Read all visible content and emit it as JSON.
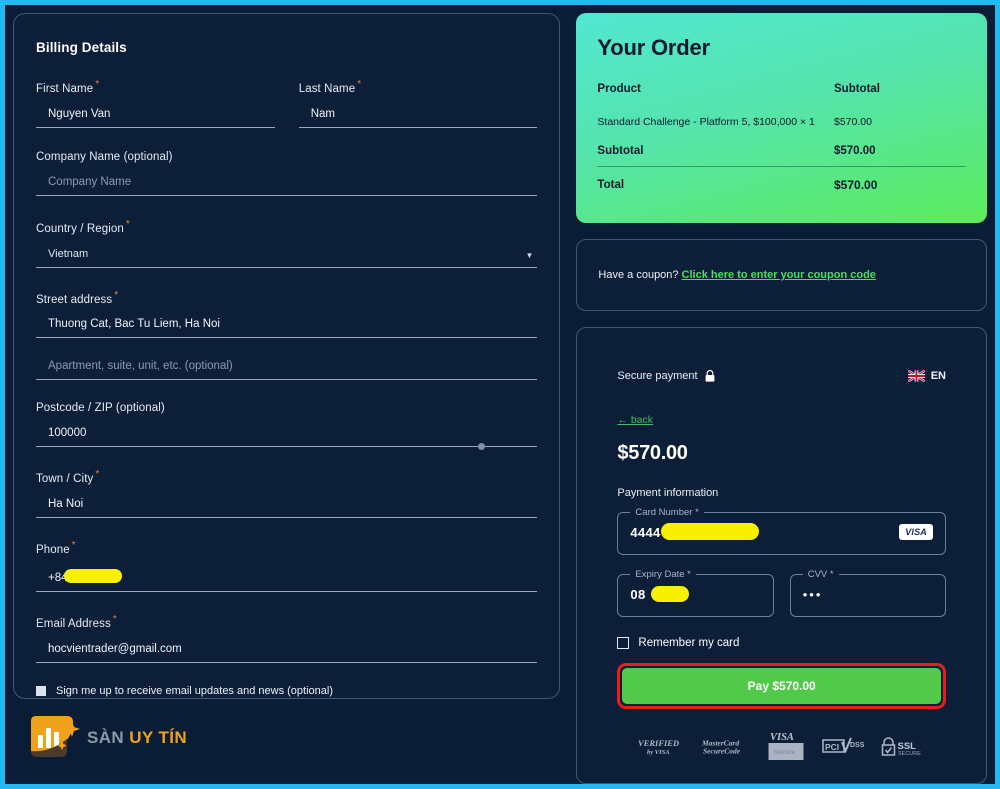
{
  "theme": {
    "outer_border": "#22b8f0",
    "page_bg": "#0b1d36",
    "panel_bg": "#0c1e38",
    "panel_border": "#3f5878",
    "required_mark": "#e8833a",
    "accent_green": "#4ade62",
    "pay_button_bg": "#52c94a",
    "annotation_red": "#ee1b1b",
    "redaction_yellow": "#f9f000",
    "order_gradient_from": "#52e7d2",
    "order_gradient_to": "#5ceb5b",
    "logo_orange": "#f0a21c"
  },
  "billing": {
    "title": "Billing Details",
    "first_name": {
      "label": "First Name",
      "required": true,
      "value": "Nguyen Van"
    },
    "last_name": {
      "label": "Last Name",
      "required": true,
      "value": "Nam"
    },
    "company": {
      "label": "Company Name (optional)",
      "required": false,
      "value": "",
      "placeholder": "Company Name"
    },
    "country": {
      "label": "Country / Region",
      "required": true,
      "value": "Vietnam"
    },
    "street": {
      "label": "Street address",
      "required": true,
      "value": "Thuong Cat, Bac Tu Liem, Ha Noi"
    },
    "street2": {
      "placeholder": "Apartment, suite, unit, etc. (optional)",
      "value": ""
    },
    "postcode": {
      "label": "Postcode / ZIP (optional)",
      "required": false,
      "value": "100000"
    },
    "city": {
      "label": "Town / City",
      "required": true,
      "value": "Ha Noi"
    },
    "phone": {
      "label": "Phone",
      "required": true,
      "value": "+84",
      "redacted": true
    },
    "email": {
      "label": "Email Address",
      "required": true,
      "value": "hocvientrader@gmail.com"
    },
    "newsletter": {
      "label": "Sign me up to receive email updates and news (optional)",
      "checked": true
    }
  },
  "logo": {
    "text_part1": "SÀN",
    "text_part2": "UY TÍN"
  },
  "order": {
    "title": "Your Order",
    "columns": {
      "product": "Product",
      "subtotal": "Subtotal"
    },
    "items": [
      {
        "name": "Standard Challenge - Platform 5, $100,000  × 1",
        "amount": "$570.00"
      }
    ],
    "subtotal_label": "Subtotal",
    "subtotal_value": "$570.00",
    "total_label": "Total",
    "total_value": "$570.00"
  },
  "coupon": {
    "prompt": "Have a coupon?",
    "link": "Click here to enter your coupon code"
  },
  "payment": {
    "secure_label": "Secure payment",
    "lock_icon": "lock-icon",
    "language": "EN",
    "flag_icon": "uk-flag-icon",
    "back_label": "← back",
    "amount": "$570.00",
    "section_label": "Payment information",
    "card_number": {
      "label": "Card Number *",
      "value": "4444",
      "redacted": true,
      "brand": "VISA"
    },
    "expiry": {
      "label": "Expiry Date *",
      "value": "08",
      "redacted": true
    },
    "cvv": {
      "label": "CVV *",
      "value": "•••"
    },
    "remember": {
      "label": "Remember my card",
      "checked": false
    },
    "pay_button": "Pay $570.00",
    "badges": [
      "VERIFIED by VISA",
      "MasterCard SecureCode",
      "VISA Secure",
      "PCI DSS",
      "SSL SECURE"
    ]
  }
}
